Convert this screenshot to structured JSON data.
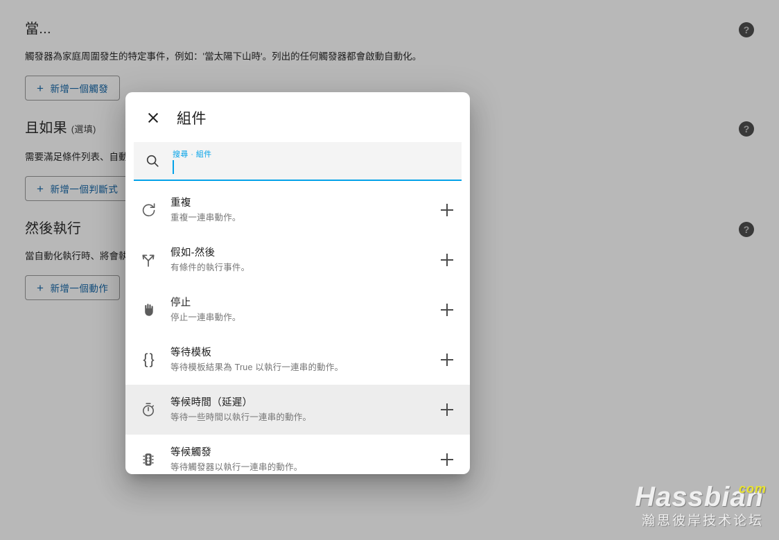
{
  "background": {
    "sections": [
      {
        "title": "當...",
        "optional": "",
        "description": "觸發器為家庭周圍發生的特定事件，例如：'當太陽下山時'。列出的任何觸發器都會啟動自動化。",
        "button_label": "新增一個觸發",
        "plus": "+",
        "help": "?"
      },
      {
        "title": "且如果",
        "optional": "(選填)",
        "description": "需要滿足條件列表、自動化才會執行。例如：'當有人 在家'。可使用組件以建立更複雜的條件。",
        "button_label": "新增一個判斷式",
        "plus": "+",
        "help": "?"
      },
      {
        "title": "然後執行",
        "optional": "",
        "description": "當自動化執行時、將會執行下列動作。可使用組件以建立更複雜的一連串動作。",
        "button_label": "新增一個動作",
        "plus": "+",
        "help": "?"
      }
    ]
  },
  "dialog": {
    "title": "組件",
    "close_icon": "close-icon",
    "search": {
      "label": "搜尋 · 組件",
      "value": "",
      "placeholder": "",
      "icon": "search-icon",
      "accent_color": "#03a2e8"
    },
    "items": [
      {
        "icon": "repeat-icon",
        "title": "重複",
        "subtitle": "重複一連串動作。",
        "add_label": "+",
        "hovered": false
      },
      {
        "icon": "call-split-icon",
        "title": "假如-然後",
        "subtitle": "有條件的執行事件。",
        "add_label": "+",
        "hovered": false
      },
      {
        "icon": "hand-stop-icon",
        "title": "停止",
        "subtitle": "停止一連串動作。",
        "add_label": "+",
        "hovered": false
      },
      {
        "icon": "curly-braces-icon",
        "title": "等待模板",
        "subtitle": "等待模板結果為 True 以執行一連串的動作。",
        "add_label": "+",
        "hovered": false
      },
      {
        "icon": "timer-icon",
        "title": "等候時間（延遲）",
        "subtitle": "等待一些時間以執行一連串的動作。",
        "add_label": "+",
        "hovered": true
      },
      {
        "icon": "traffic-light-icon",
        "title": "等候觸發",
        "subtitle": "等待觸發器以執行一連串的動作。",
        "add_label": "+",
        "hovered": false
      }
    ]
  },
  "watermark": {
    "main": "Hassbian",
    "com": "com",
    "sub": "瀚思彼岸技术论坛"
  }
}
